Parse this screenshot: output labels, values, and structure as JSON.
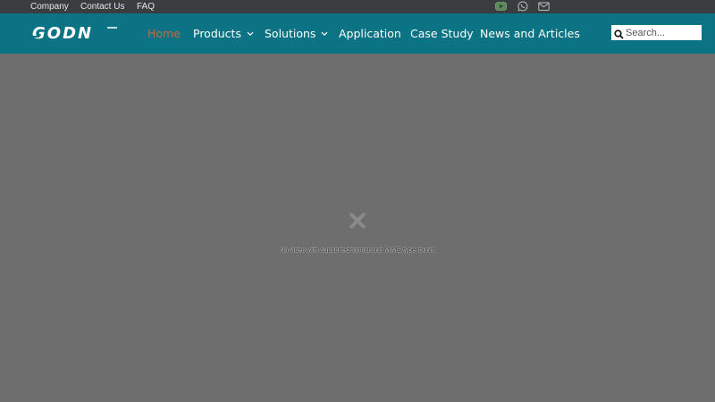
{
  "topbar": {
    "links": [
      "Company",
      "Contact Us",
      "FAQ"
    ],
    "social_icons": [
      "youtube-icon",
      "whatsapp-icon",
      "mail-icon"
    ]
  },
  "header": {
    "logo_text": "GODN",
    "nav": [
      {
        "label": "Home",
        "active": true,
        "has_dropdown": false
      },
      {
        "label": "Products",
        "active": false,
        "has_dropdown": true
      },
      {
        "label": "Solutions",
        "active": false,
        "has_dropdown": true
      },
      {
        "label": "Application",
        "active": false,
        "has_dropdown": false
      },
      {
        "label": "Case Study",
        "active": false,
        "has_dropdown": false
      },
      {
        "label": "News and Articles",
        "active": false,
        "has_dropdown": false
      }
    ],
    "search": {
      "placeholder": "Search...",
      "value": ""
    }
  },
  "video": {
    "error_icon": "close-icon",
    "error_message": "No video with supported format and MIME type found."
  },
  "colors": {
    "topbar_bg": "#3a3d40",
    "header_bg": "#0b7384",
    "active_nav": "#c56a3f",
    "video_bg": "#6e6e6e"
  }
}
